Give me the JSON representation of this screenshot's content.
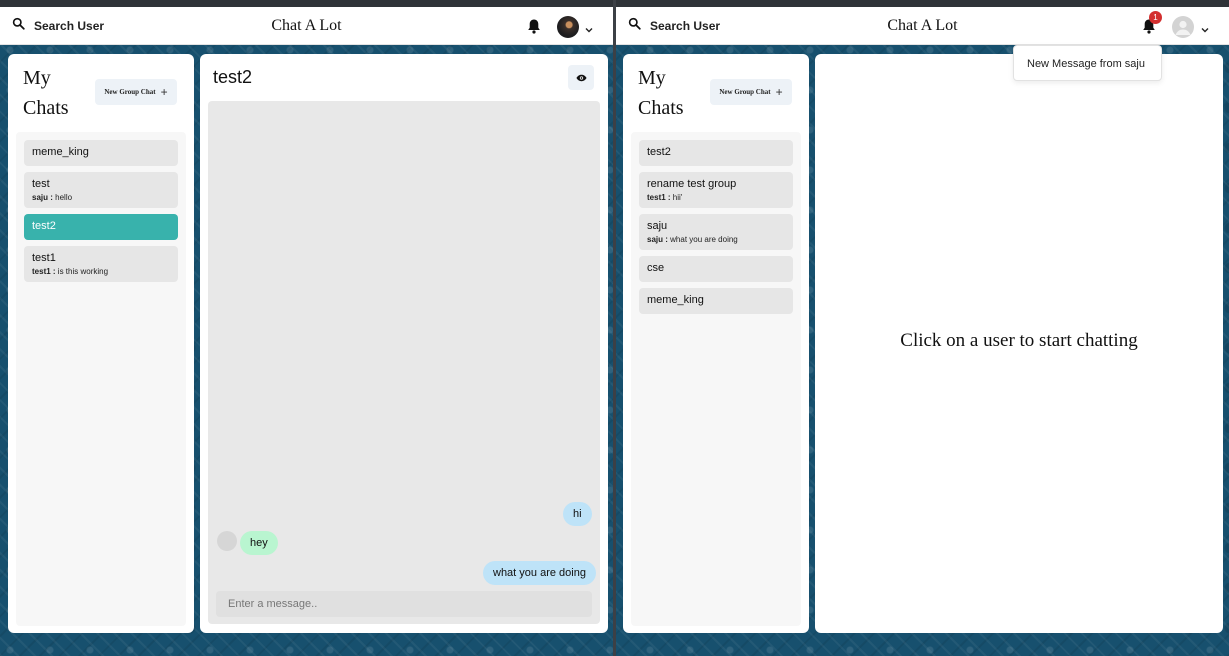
{
  "left": {
    "header": {
      "search_label": "Search User",
      "app_title": "Chat A Lot"
    },
    "sidebar": {
      "title": "My Chats",
      "new_group_label": "New Group Chat",
      "chats": [
        {
          "name": "meme_king",
          "latest_sender": "",
          "latest_text": "",
          "active": false
        },
        {
          "name": "test",
          "latest_sender": "saju :",
          "latest_text": "hello",
          "active": false
        },
        {
          "name": "test2",
          "latest_sender": "",
          "latest_text": "",
          "active": true
        },
        {
          "name": "test1",
          "latest_sender": "test1 :",
          "latest_text": "is this working",
          "active": false
        }
      ]
    },
    "chat": {
      "title": "test2",
      "messages": [
        {
          "text": "hi",
          "mine": true
        },
        {
          "text": "hey",
          "mine": false
        },
        {
          "text": "what you are doing",
          "mine": true
        }
      ],
      "input_placeholder": "Enter a message.."
    }
  },
  "right": {
    "header": {
      "search_label": "Search User",
      "app_title": "Chat A Lot",
      "notification_count": "1"
    },
    "notifications": [
      "New Message from saju"
    ],
    "sidebar": {
      "title": "My Chats",
      "new_group_label": "New Group Chat",
      "chats": [
        {
          "name": "test2",
          "latest_sender": "",
          "latest_text": "",
          "active": false
        },
        {
          "name": "rename test group",
          "latest_sender": "test1 :",
          "latest_text": "hii'",
          "active": false
        },
        {
          "name": "saju",
          "latest_sender": "saju :",
          "latest_text": "what you are doing",
          "active": false
        },
        {
          "name": "cse",
          "latest_sender": "",
          "latest_text": "",
          "active": false
        },
        {
          "name": "meme_king",
          "latest_sender": "",
          "latest_text": "",
          "active": false
        }
      ]
    },
    "empty_text": "Click on a user to start chatting"
  },
  "colors": {
    "active_chat": "#38b2ac",
    "my_bubble": "#bee3f8",
    "their_bubble": "#b9f5d0",
    "badge": "#d32f2f",
    "background": "#17506e"
  },
  "icons": [
    "search-icon",
    "bell-icon",
    "chevron-down-icon",
    "plus-icon",
    "eye-icon",
    "avatar"
  ]
}
